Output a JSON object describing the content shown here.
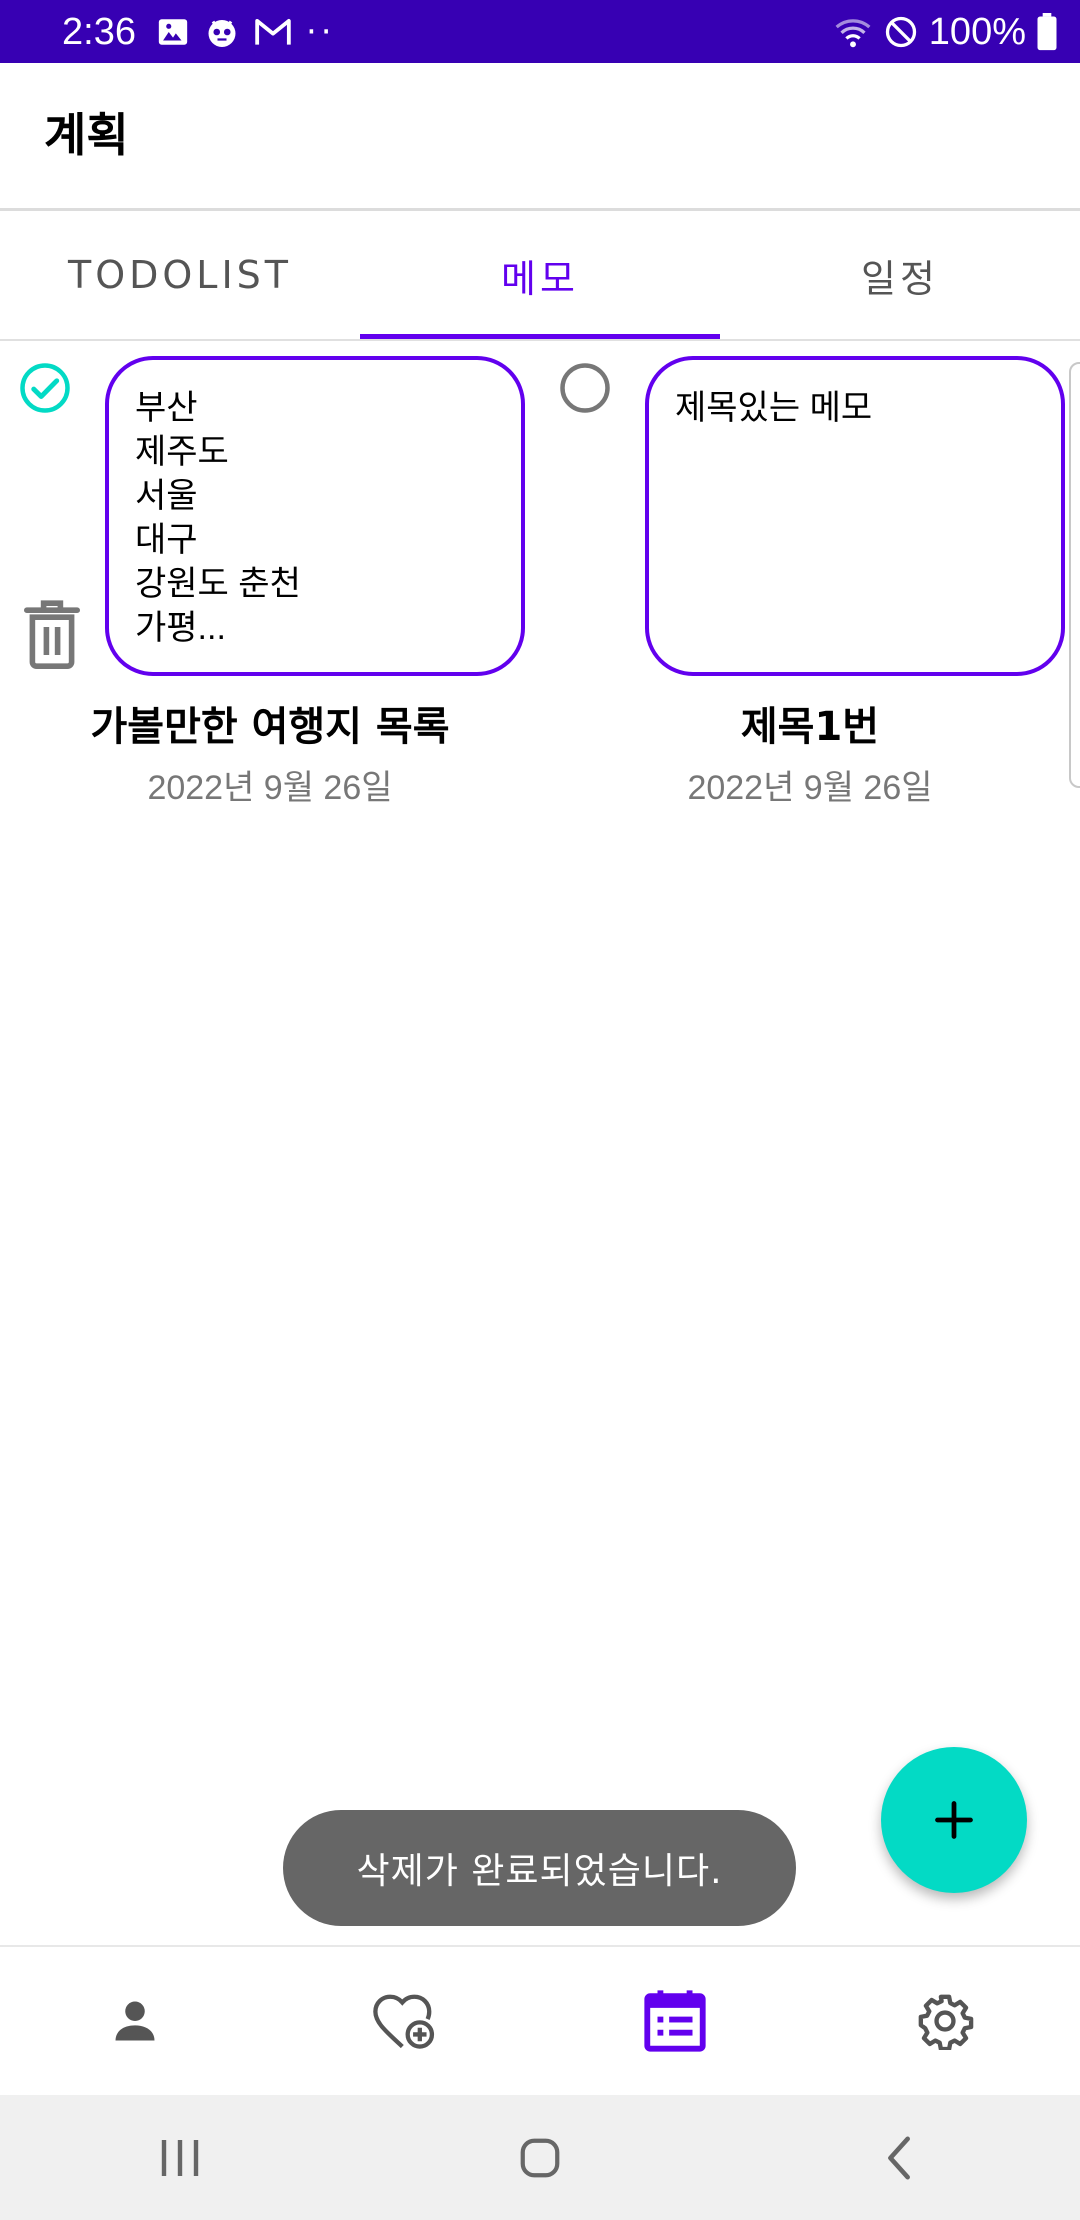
{
  "status_bar": {
    "time": "2:36",
    "battery": "100%",
    "overflow_dots": "··",
    "icons_left": [
      "image-icon",
      "app-mascot-icon",
      "gmail-icon"
    ],
    "icons_right": [
      "wifi-icon",
      "dnd-icon",
      "battery-icon"
    ]
  },
  "toolbar": {
    "title": "계획"
  },
  "tabs": [
    {
      "label": "TODOLIST",
      "active": false
    },
    {
      "label": "메모",
      "active": true
    },
    {
      "label": "일정",
      "active": false
    }
  ],
  "memos": [
    {
      "content": "부산\n제주도\n서울\n대구\n강원도 춘천\n가평...",
      "title": "가볼만한 여행지 목록",
      "date": "2022년 9월 26일",
      "selected": true
    },
    {
      "content": "제목있는 메모",
      "title": "제목1번",
      "date": "2022년 9월 26일",
      "selected": false
    }
  ],
  "toast": {
    "message": "삭제가 완료되었습니다."
  },
  "fab": {
    "icon": "plus-icon"
  },
  "bottom_nav": [
    {
      "icon": "person-icon",
      "active": false
    },
    {
      "icon": "heart-plus-icon",
      "active": false
    },
    {
      "icon": "calendar-list-icon",
      "active": true
    },
    {
      "icon": "gear-icon",
      "active": false
    }
  ],
  "system_nav": [
    "recent-apps-icon",
    "home-icon",
    "back-icon"
  ],
  "colors": {
    "status_bar": "#3700b3",
    "primary": "#6200ee",
    "accent": "#03dac5",
    "toast_bg": "#666666"
  }
}
